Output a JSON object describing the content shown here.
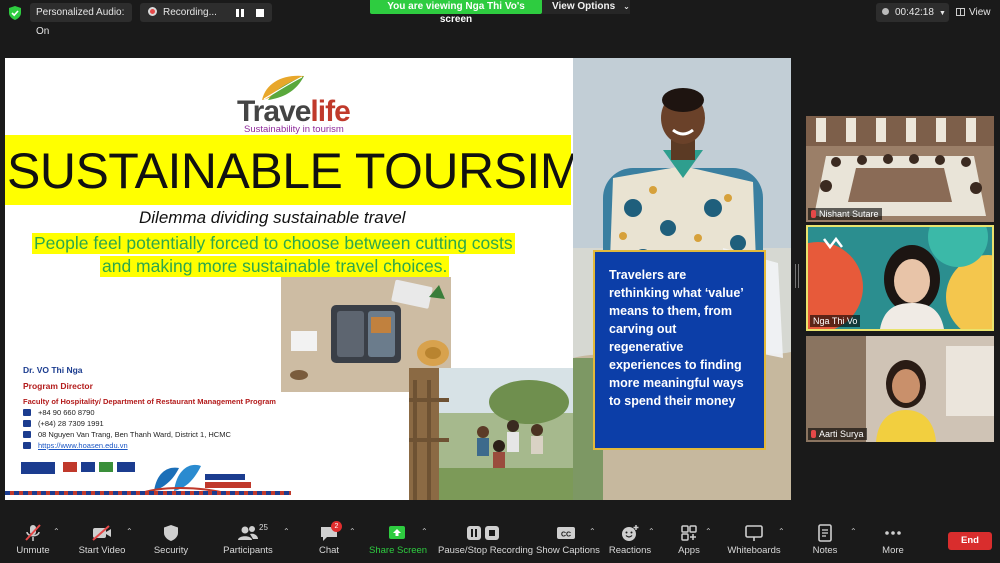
{
  "topbar": {
    "audio_label": "Personalized Audio: On",
    "recording_label": "Recording...",
    "viewing_banner": "You are viewing Nga Thi Vo's screen",
    "view_options_label": "View Options",
    "timer": "00:42:18",
    "view_label": "View"
  },
  "slide": {
    "logo_word_a": "Trave",
    "logo_word_b": "life",
    "logo_tagline": "Sustainability in tourism",
    "title": "SUSTAINABLE TOURSIM",
    "subtitle": "Dilemma dividing sustainable travel",
    "highlight_line_1": "People feel potentially forced to choose between cutting costs",
    "highlight_line_2": "and making more sustainable travel choices.",
    "quote": "Travelers are rethinking what ‘value’ means to them, from carving out regenerative experiences to finding more meaningful ways to spend their money",
    "contact": {
      "name": "Dr. VO Thi Nga",
      "role": "Program Director",
      "faculty": "Faculty of Hospitality/ Department of Restaurant Management Program",
      "phone": "+84 90 660 8790",
      "office_phone": "(+84) 28 7309 1991",
      "address": "08 Nguyen Van Trang, Ben Thanh Ward, District 1, HCMC",
      "website": "https://www.hoasen.edu.vn"
    },
    "colors": {
      "title_band": "#ffff00",
      "highlight_text": "#2ea84a",
      "quote_box": "#0c3ea8",
      "quote_border": "#e2b93b"
    }
  },
  "participants": [
    {
      "name": "Nishant Sutare",
      "muted": true
    },
    {
      "name": "Nga Thi Vo",
      "muted": false,
      "active_speaker": true
    },
    {
      "name": "Aarti Surya",
      "muted": true
    }
  ],
  "toolbar": {
    "unmute": "Unmute",
    "start_video": "Start Video",
    "security": "Security",
    "participants": "Participants",
    "participants_count": "25",
    "chat": "Chat",
    "chat_badge": "2",
    "share_screen": "Share Screen",
    "pause_recording": "Pause/Stop Recording",
    "show_captions": "Show Captions",
    "reactions": "Reactions",
    "apps": "Apps",
    "whiteboards": "Whiteboards",
    "notes": "Notes",
    "more": "More",
    "end": "End"
  }
}
